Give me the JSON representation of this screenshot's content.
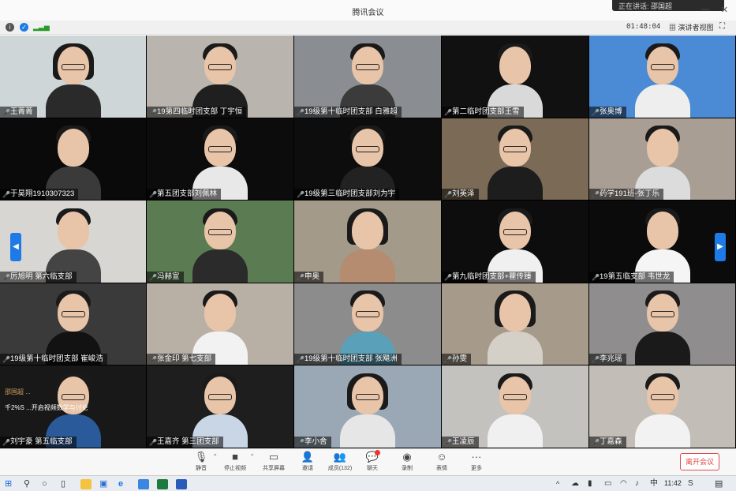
{
  "window": {
    "title": "腾讯会议",
    "speaking_banner": "正在讲话: 邵国超",
    "timer": "01:48:04",
    "speaker_view": "演讲者视图"
  },
  "colors": {
    "accent": "#1e7ae6",
    "leave": "#e04b4b",
    "tile_bg": "#000000"
  },
  "participants": [
    {
      "name": "王菁菁",
      "bg": "#cfd6d8",
      "body": "#2a2a2a",
      "glasses": true,
      "hair": "long"
    },
    {
      "name": "19第四临时团支部 丁宇恒",
      "bg": "#b9b4ad",
      "body": "#1f1f1f",
      "glasses": true
    },
    {
      "name": "19级第十临时团支部 白雅超",
      "bg": "#8a8e93",
      "body": "#3b3b3b",
      "glasses": true
    },
    {
      "name": "第二临时团支部王雪",
      "bg": "#111111",
      "body": "#d9d9d9",
      "glasses": false
    },
    {
      "name": "张奥博",
      "bg": "#4b8bd6",
      "body": "#eeeeee",
      "glasses": true
    },
    {
      "name": "于昊翔1910307323",
      "bg": "#0a0a0a",
      "body": "#3a3a3a",
      "glasses": false
    },
    {
      "name": "第五团支部刘佩林",
      "bg": "#0c0c0c",
      "body": "#e8e8e8",
      "glasses": true
    },
    {
      "name": "19级第三临时团支部刘为宇",
      "bg": "#0d0d0d",
      "body": "#222222",
      "glasses": true
    },
    {
      "name": "刘英泽",
      "bg": "#7b6a55",
      "body": "#1d1d1d",
      "glasses": true
    },
    {
      "name": "药学191班-张丁乐",
      "bg": "#a89e93",
      "body": "#dcdcdc",
      "glasses": false
    },
    {
      "name": "厉旭明 第六临支部",
      "bg": "#d8d6d2",
      "body": "#444444",
      "glasses": false
    },
    {
      "name": "冯赫宣",
      "bg": "#5b7b52",
      "body": "#2b2b2b",
      "glasses": true
    },
    {
      "name": "申奥",
      "bg": "#a39a8a",
      "body": "#b58c70",
      "glasses": false,
      "hair": "long"
    },
    {
      "name": "第九临时团支部+瞿传臻",
      "bg": "#0d0d0d",
      "body": "#f0f0f0",
      "glasses": true
    },
    {
      "name": "19第五临支部 韦世龙",
      "bg": "#0b0b0b",
      "body": "#f5f5f5",
      "glasses": false
    },
    {
      "name": "19级第十临时团支部 崔峻浩",
      "bg": "#3a3a3a",
      "body": "#121212",
      "glasses": true
    },
    {
      "name": "张金印 第七支部",
      "bg": "#b8b0a5",
      "body": "#f2f2f2",
      "glasses": false
    },
    {
      "name": "19级第十临时团支部 张飓洲",
      "bg": "#8c8c8c",
      "body": "#5aa0b8",
      "glasses": true
    },
    {
      "name": "孙雯",
      "bg": "#a69a8a",
      "body": "#d4d0c8",
      "glasses": false,
      "hair": "long"
    },
    {
      "name": "李兆瑶",
      "bg": "#8f8d8e",
      "body": "#1a1a1a",
      "glasses": true
    },
    {
      "name": "刘宇豪 第五临支部",
      "bg": "#181818",
      "body": "#2a5a9a",
      "glasses": true
    },
    {
      "name": "王嘉齐 第三团支部",
      "bg": "#1e1e1e",
      "body": "#c9d6e6",
      "glasses": true
    },
    {
      "name": "李小舍",
      "bg": "#9aa8b5",
      "body": "#e6e6e6",
      "glasses": true,
      "hair": "long"
    },
    {
      "name": "王凌辰",
      "bg": "#c4c2be",
      "body": "#f0f0f0",
      "glasses": true
    },
    {
      "name": "丁嘉森",
      "bg": "#c2bdb6",
      "body": "#f2f2f2",
      "glasses": true
    }
  ],
  "chat_overlay": {
    "line1": "邵国超 ...",
    "line2": "千2%S ...开启视频数学与讨论"
  },
  "toolbar": {
    "mute": "静音",
    "stop_video": "停止视频",
    "share_screen": "共享屏幕",
    "invite": "邀请",
    "members": "成员(132)",
    "chat": "聊天",
    "record": "录制",
    "reactions": "表情",
    "more": "更多",
    "leave": "离开会议"
  },
  "taskbar": {
    "time": "11:42",
    "ime": "中",
    "lang": "S"
  }
}
